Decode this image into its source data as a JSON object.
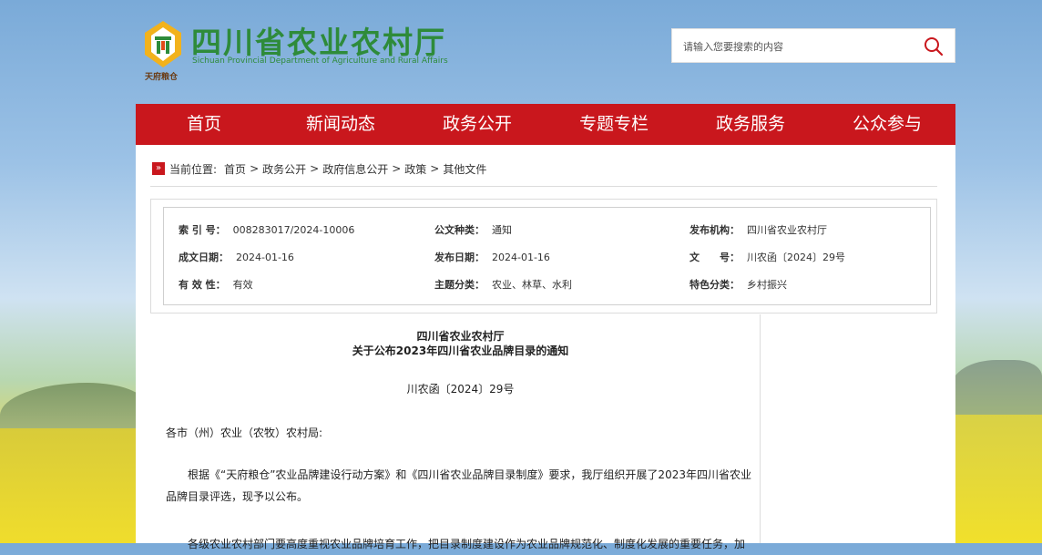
{
  "site": {
    "title": "四川省农业农村厅",
    "subtitle": "Sichuan Provincial Department of Agriculture and Rural Affairs",
    "logo_caption": "天府粮仓",
    "accent": "#c9171d",
    "brand_green": "#2e8b3a"
  },
  "search": {
    "placeholder": "请输入您要搜索的内容",
    "icon": "search-icon"
  },
  "nav": {
    "items": [
      {
        "label": "首页"
      },
      {
        "label": "新闻动态"
      },
      {
        "label": "政务公开"
      },
      {
        "label": "专题专栏"
      },
      {
        "label": "政务服务"
      },
      {
        "label": "公众参与"
      }
    ]
  },
  "breadcrumb": {
    "prefix": "当前位置:",
    "items": [
      "首页",
      "政务公开",
      "政府信息公开",
      "政策",
      "其他文件"
    ],
    "separator": ">"
  },
  "info": {
    "index_label": "索 引 号：",
    "index_value": "008283017/2024-10006",
    "type_label": "公文种类：",
    "type_value": "通知",
    "issuer_label": "发布机构：",
    "issuer_value": "四川省农业农村厅",
    "created_label": "成文日期：",
    "created_value": "2024-01-16",
    "published_label": "发布日期：",
    "published_value": "2024-01-16",
    "docno_label": "文　　号：",
    "docno_value": "川农函〔2024〕29号",
    "validity_label": "有 效 性：",
    "validity_value": "有效",
    "topic_label": "主题分类：",
    "topic_value": "农业、林草、水利",
    "feature_label": "特色分类：",
    "feature_value": "乡村振兴"
  },
  "article": {
    "org": "四川省农业农村厅",
    "title": "关于公布2023年四川省农业品牌目录的通知",
    "doc_no": "川农函〔2024〕29号",
    "salutation": "各市（州）农业（农牧）农村局:",
    "para1": "根据《“天府粮仓”农业品牌建设行动方案》和《四川省农业品牌目录制度》要求，我厅组织开展了2023年四川省农业品牌目录评选，现予以公布。",
    "para2": "各级农业农村部门要高度重视农业品牌培育工作，把目录制度建设作为农业品牌规范化、制度化发展的重要任务，加"
  }
}
